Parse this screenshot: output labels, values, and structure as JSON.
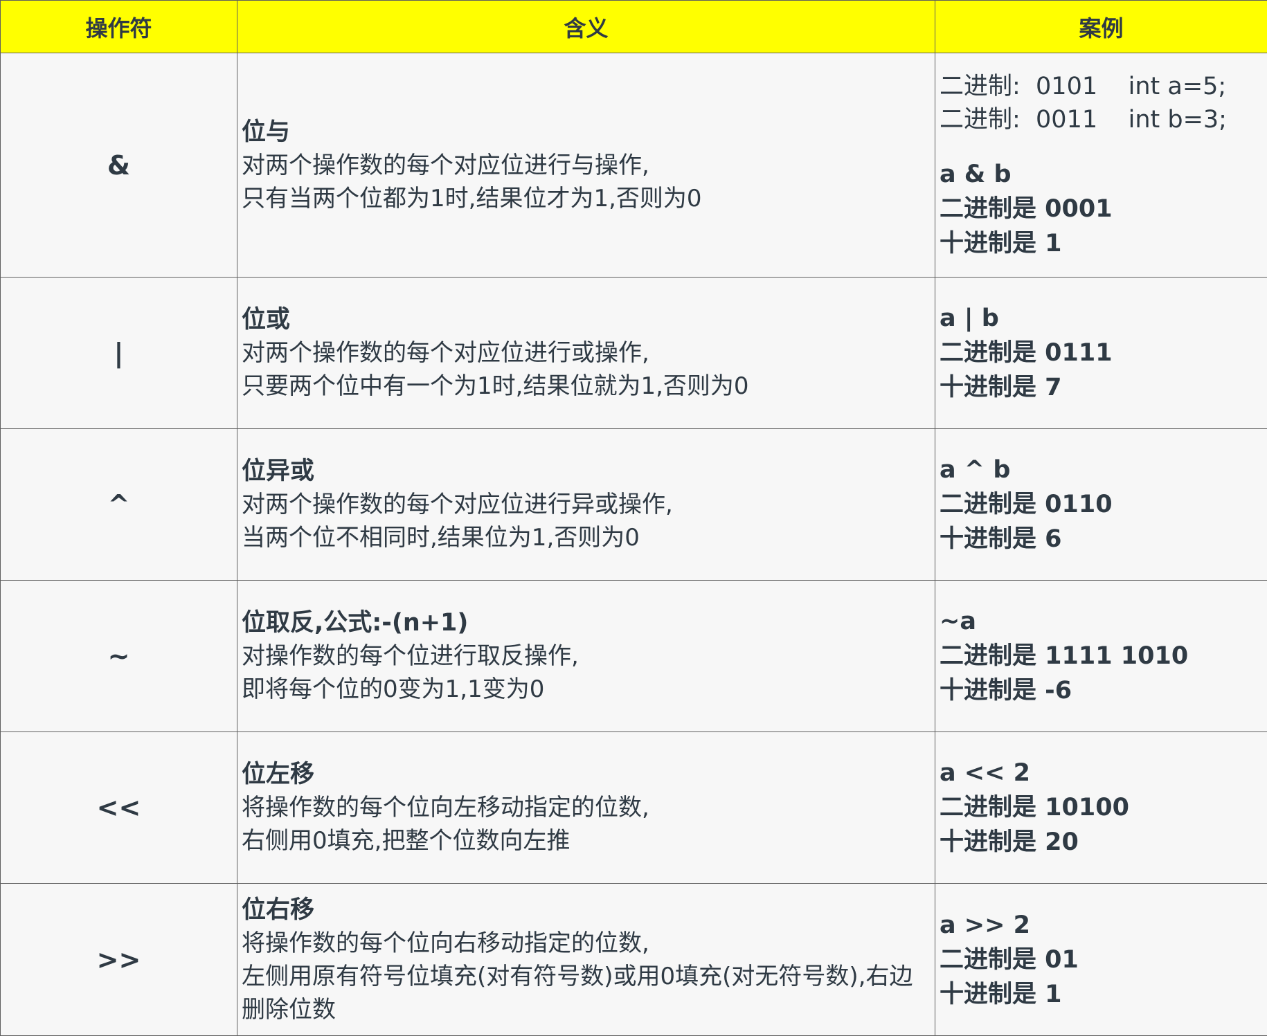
{
  "header": {
    "col_operator": "操作符",
    "col_meaning": "含义",
    "col_example": "案例"
  },
  "rows": [
    {
      "operator": "&",
      "title": "位与",
      "lines": [
        "对两个操作数的每个对应位进行与操作,",
        "只有当两个位都为1时,结果位才为1,否则为0"
      ],
      "setup": [
        "二进制:  0101    int a=5;",
        "二进制:  0011    int b=3;"
      ],
      "expr": "a & b",
      "bin": "二进制是 0001",
      "dec": "十进制是 1"
    },
    {
      "operator": "|",
      "title": "位或",
      "lines": [
        "对两个操作数的每个对应位进行或操作,",
        "只要两个位中有一个为1时,结果位就为1,否则为0"
      ],
      "expr": "a | b",
      "bin": "二进制是 0111",
      "dec": "十进制是 7"
    },
    {
      "operator": "^",
      "title": "位异或",
      "lines": [
        "对两个操作数的每个对应位进行异或操作,",
        "当两个位不相同时,结果位为1,否则为0"
      ],
      "expr": "a ^ b",
      "bin": "二进制是 0110",
      "dec": "十进制是 6"
    },
    {
      "operator": "~",
      "title": "位取反,公式:-(n+1)",
      "lines": [
        "对操作数的每个位进行取反操作,",
        "即将每个位的0变为1,1变为0"
      ],
      "expr": "~a",
      "bin": "二进制是 1111 1010",
      "dec": "十进制是 -6"
    },
    {
      "operator": "<<",
      "title": "位左移",
      "lines": [
        "将操作数的每个位向左移动指定的位数,",
        "右侧用0填充,把整个位数向左推"
      ],
      "expr": "a << 2",
      "bin": "二进制是 10100",
      "dec": "十进制是 20"
    },
    {
      "operator": ">>",
      "title": "位右移",
      "lines": [
        "将操作数的每个位向右移动指定的位数,",
        "左侧用原有符号位填充(对有符号数)或用0填充(对无符号数),右边删除位数"
      ],
      "expr": "a >> 2",
      "bin": "二进制是 01",
      "dec": "十进制是 1"
    }
  ]
}
